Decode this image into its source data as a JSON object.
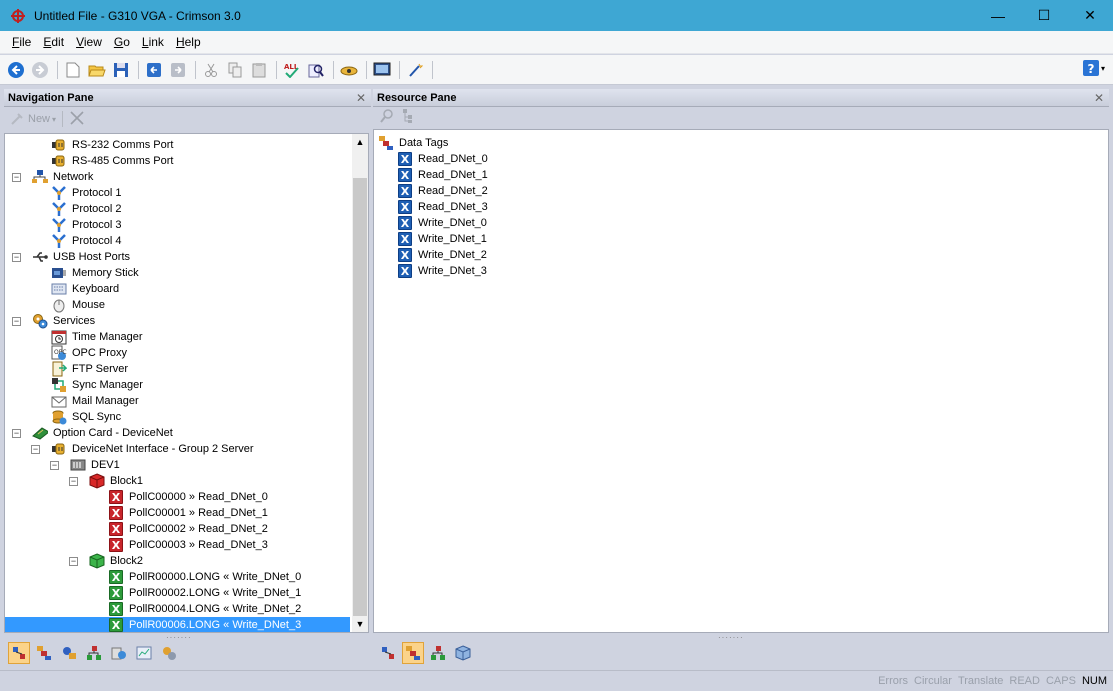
{
  "window": {
    "title": "Untitled File - G310 VGA - Crimson 3.0",
    "minimize": "—",
    "maximize": "☐",
    "close": "✕"
  },
  "menu": [
    {
      "ul": "F",
      "rest": "ile"
    },
    {
      "ul": "E",
      "rest": "dit"
    },
    {
      "ul": "V",
      "rest": "iew"
    },
    {
      "ul": "G",
      "rest": "o"
    },
    {
      "ul": "L",
      "rest": "ink"
    },
    {
      "ul": "H",
      "rest": "elp"
    }
  ],
  "nav_pane": {
    "title": "Navigation Pane",
    "new_label": "New",
    "tree": [
      {
        "label": "RS-232 Comms Port",
        "depth": 1,
        "icon": "serial-port-icon"
      },
      {
        "label": "RS-485 Comms Port",
        "depth": 1,
        "icon": "serial-port-icon"
      },
      {
        "label": "Network",
        "depth": 0,
        "icon": "network-icon",
        "exp": "−"
      },
      {
        "label": "Protocol 1",
        "depth": 1,
        "icon": "protocol-icon"
      },
      {
        "label": "Protocol 2",
        "depth": 1,
        "icon": "protocol-icon"
      },
      {
        "label": "Protocol 3",
        "depth": 1,
        "icon": "protocol-icon"
      },
      {
        "label": "Protocol 4",
        "depth": 1,
        "icon": "protocol-icon"
      },
      {
        "label": "USB Host Ports",
        "depth": 0,
        "icon": "usb-icon",
        "exp": "−"
      },
      {
        "label": "Memory Stick",
        "depth": 1,
        "icon": "memory-stick-icon"
      },
      {
        "label": "Keyboard",
        "depth": 1,
        "icon": "keyboard-icon"
      },
      {
        "label": "Mouse",
        "depth": 1,
        "icon": "mouse-icon"
      },
      {
        "label": "Services",
        "depth": 0,
        "icon": "services-icon",
        "exp": "−"
      },
      {
        "label": "Time Manager",
        "depth": 1,
        "icon": "clock-icon"
      },
      {
        "label": "OPC Proxy",
        "depth": 1,
        "icon": "opc-icon"
      },
      {
        "label": "FTP Server",
        "depth": 1,
        "icon": "ftp-icon"
      },
      {
        "label": "Sync Manager",
        "depth": 1,
        "icon": "sync-icon"
      },
      {
        "label": "Mail Manager",
        "depth": 1,
        "icon": "mail-icon"
      },
      {
        "label": "SQL Sync",
        "depth": 1,
        "icon": "sql-icon"
      },
      {
        "label": "Option Card - DeviceNet",
        "depth": 0,
        "icon": "option-card-icon",
        "exp": "−"
      },
      {
        "label": "DeviceNet Interface - Group 2 Server",
        "depth": 1,
        "icon": "serial-port-icon",
        "exp": "−"
      },
      {
        "label": "DEV1",
        "depth": 2,
        "icon": "device-icon",
        "exp": "−"
      },
      {
        "label": "Block1",
        "depth": 3,
        "icon": "red-block-icon",
        "exp": "−"
      },
      {
        "label": "PollC00000 » Read_DNet_0",
        "depth": 4,
        "icon": "red-x-icon"
      },
      {
        "label": "PollC00001 » Read_DNet_1",
        "depth": 4,
        "icon": "red-x-icon"
      },
      {
        "label": "PollC00002 » Read_DNet_2",
        "depth": 4,
        "icon": "red-x-icon"
      },
      {
        "label": "PollC00003 » Read_DNet_3",
        "depth": 4,
        "icon": "red-x-icon"
      },
      {
        "label": "Block2",
        "depth": 3,
        "icon": "green-block-icon",
        "exp": "−"
      },
      {
        "label": "PollR00000.LONG « Write_DNet_0",
        "depth": 4,
        "icon": "green-x-icon"
      },
      {
        "label": "PollR00002.LONG « Write_DNet_1",
        "depth": 4,
        "icon": "green-x-icon"
      },
      {
        "label": "PollR00004.LONG « Write_DNet_2",
        "depth": 4,
        "icon": "green-x-icon"
      },
      {
        "label": "PollR00006.LONG « Write_DNet_3",
        "depth": 4,
        "icon": "green-x-icon",
        "selected": true
      }
    ]
  },
  "resource_pane": {
    "title": "Resource Pane",
    "root": "Data Tags",
    "tags": [
      "Read_DNet_0",
      "Read_DNet_1",
      "Read_DNet_2",
      "Read_DNet_3",
      "Write_DNet_0",
      "Write_DNet_1",
      "Write_DNet_2",
      "Write_DNet_3"
    ]
  },
  "status": [
    {
      "text": "Errors",
      "on": false
    },
    {
      "text": "Circular",
      "on": false
    },
    {
      "text": "Translate",
      "on": false
    },
    {
      "text": "READ",
      "on": false
    },
    {
      "text": "CAPS",
      "on": false
    },
    {
      "text": "NUM",
      "on": true
    }
  ],
  "colors": {
    "titlebar": "#3ea7d3",
    "selection": "#3399ff",
    "pane_bg": "#cfd3e0"
  }
}
